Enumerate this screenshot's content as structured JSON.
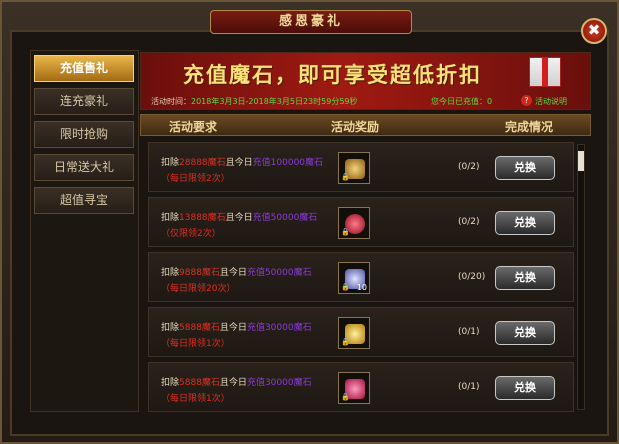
{
  "window": {
    "title": "感恩豪礼",
    "close_label": "✖"
  },
  "sidebar": {
    "items": [
      {
        "label": "充值售礼",
        "active": true
      },
      {
        "label": "连充豪礼",
        "active": false
      },
      {
        "label": "限时抢购",
        "active": false
      },
      {
        "label": "日常送大礼",
        "active": false
      },
      {
        "label": "超值寻宝",
        "active": false
      }
    ]
  },
  "banner": {
    "title": "充值魔石，即可享受超低折扣",
    "time_label": "活动时间：",
    "time_value": "2018年3月3日-2018年3月5日23时59分59秒",
    "charged_label": "您今日已充值：0",
    "help_icon": "question-icon",
    "help_label": "活动说明"
  },
  "table": {
    "headers": [
      "活动要求",
      "活动奖励",
      "完成情况"
    ],
    "rows": [
      {
        "deduct": "28888魔石",
        "charge": "充值100000魔石",
        "limit": "（每日限领2次）",
        "progress": "(0/2)",
        "count": "",
        "gem_color": "#c9a24a",
        "button": "兑换"
      },
      {
        "deduct": "13888魔石",
        "charge": "充值50000魔石",
        "limit": "（仅限领2次）",
        "progress": "(0/2)",
        "count": "",
        "gem_color": "#d0203a",
        "button": "兑换"
      },
      {
        "deduct": "9888魔石",
        "charge": "充值50000魔石",
        "limit": "（每日限领20次）",
        "progress": "(0/20)",
        "count": "10",
        "gem_color": "#9aa0e0",
        "button": "兑换"
      },
      {
        "deduct": "5888魔石",
        "charge": "充值30000魔石",
        "limit": "（每日限领1次）",
        "progress": "(0/1)",
        "count": "",
        "gem_color": "#e6b020",
        "button": "兑换"
      },
      {
        "deduct": "5888魔石",
        "charge": "充值30000魔石",
        "limit": "（每日限领1次）",
        "progress": "(0/1)",
        "count": "",
        "gem_color": "#e0306a",
        "button": "兑换"
      }
    ],
    "text_deduct": "扣除",
    "text_and_today": "且今日"
  }
}
